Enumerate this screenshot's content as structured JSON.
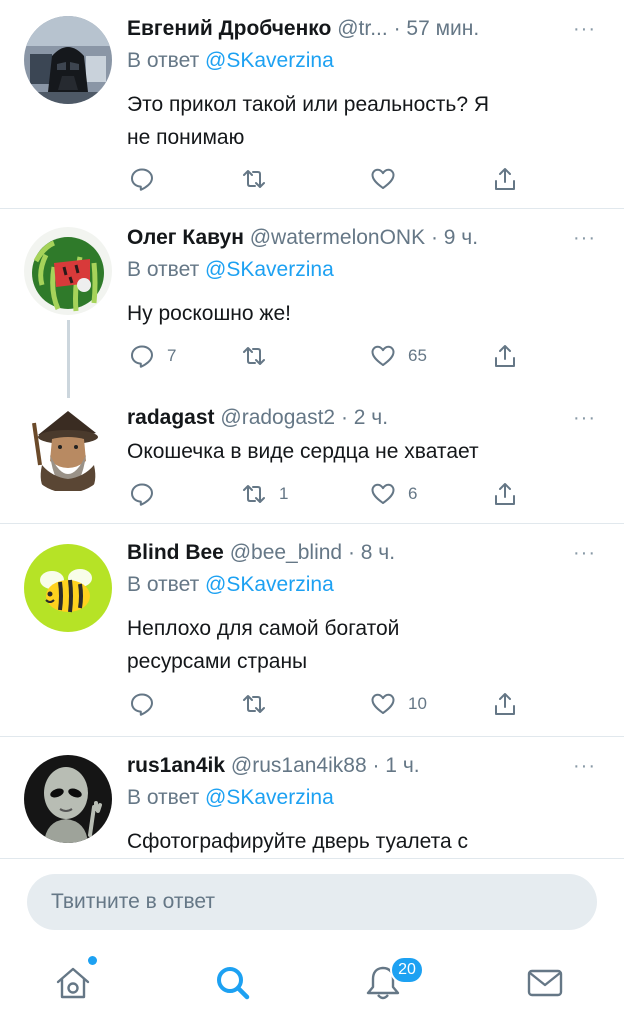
{
  "tweets": [
    {
      "name": "Евгений Дробченко",
      "handle": "@tr...",
      "time": "· 57 мин.",
      "more": "···",
      "reply_prefix": "В ответ",
      "reply_to": "@SKaverzina",
      "text_lines": [
        "Это прикол такой или реальность? Я",
        "не понимаю"
      ],
      "replies": "",
      "retweets": "",
      "likes": "",
      "avatar": "darth-vader-avatar"
    },
    {
      "name": "Олег Кавун",
      "handle": "@watermelonONK",
      "time": "· 9 ч.",
      "more": "···",
      "reply_prefix": "В ответ",
      "reply_to": "@SKaverzina",
      "text_lines": [
        "Ну роскошно же!"
      ],
      "replies": "7",
      "retweets": "",
      "likes": "65",
      "avatar": "watermelon-avatar"
    },
    {
      "name": "radagast",
      "handle": "@radogast2",
      "time": "· 2 ч.",
      "more": "···",
      "text_lines": [
        "Окошечка в виде сердца не хватает"
      ],
      "replies": "",
      "retweets": "1",
      "likes": "6",
      "avatar": "wizard-avatar"
    },
    {
      "name": "Blind Bee",
      "handle": "@bee_blind",
      "time": "· 8 ч.",
      "more": "···",
      "reply_prefix": "В ответ",
      "reply_to": "@SKaverzina",
      "text_lines": [
        "Неплохо для самой богатой",
        "ресурсами страны"
      ],
      "replies": "",
      "retweets": "",
      "likes": "10",
      "avatar": "bee-avatar"
    },
    {
      "name": "rus1an4ik",
      "handle": "@rus1an4ik88",
      "time": "· 1 ч.",
      "more": "···",
      "reply_prefix": "В ответ",
      "reply_to": "@SKaverzina",
      "text_lines": [
        "Сфотографируйте дверь туалета с"
      ],
      "avatar": "alien-avatar"
    }
  ],
  "compose": {
    "placeholder": "Твитните в ответ"
  },
  "tabbar": {
    "items": [
      {
        "icon": "home-icon",
        "indicator": "blue-dot"
      },
      {
        "icon": "search-icon",
        "active": true
      },
      {
        "icon": "notifications-icon",
        "badge": "20"
      },
      {
        "icon": "messages-icon"
      }
    ]
  },
  "colors": {
    "accent": "#1da1f2",
    "muted": "#657786",
    "divider": "#e1e8ed",
    "compose_bg": "#e6ecf0"
  }
}
